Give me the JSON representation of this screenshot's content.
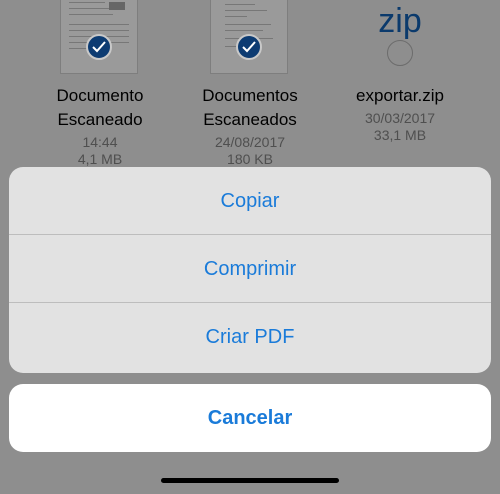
{
  "files": [
    {
      "name": "Documento Escaneado",
      "time": "14:44",
      "size": "4,1 MB",
      "selected": true
    },
    {
      "name": "Documentos Escaneados",
      "time": "24/08/2017",
      "size": "180 KB",
      "selected": true
    },
    {
      "name": "exportar.zip",
      "time": "30/03/2017",
      "size": "33,1 MB",
      "selected": false,
      "icon_text": "zip"
    }
  ],
  "actions": {
    "copy": "Copiar",
    "compress": "Comprimir",
    "create_pdf": "Criar PDF",
    "cancel": "Cancelar"
  },
  "colors": {
    "accent": "#1a7bd9",
    "dim_background": "#8e8e8e",
    "action_group_bg": "#e2e2e2",
    "cancel_bg": "#ffffff"
  }
}
